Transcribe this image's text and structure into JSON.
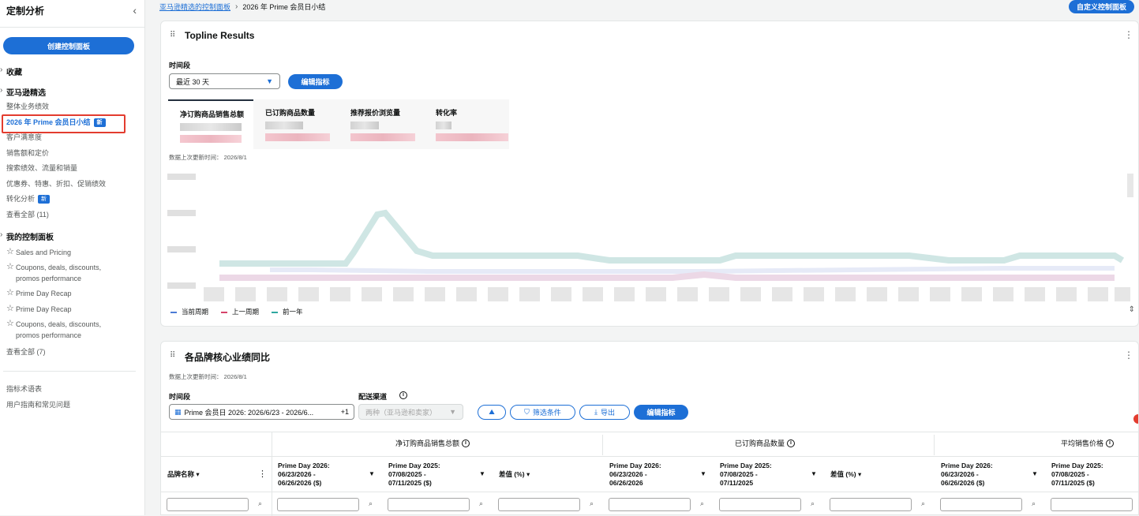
{
  "sidebar": {
    "title": "定制分析",
    "create_button": "创建控制面板",
    "favorites": "收藏",
    "amazon_section": "亚马逊精选",
    "amazon_items": [
      "整体业务绩效",
      "2026 年 Prime 会员日小结",
      "客户满意度",
      "销售额和定价",
      "搜索绩效、流量和销量",
      "优惠券、特惠、折扣、促销绩效",
      "转化分析",
      "查看全部 (11)"
    ],
    "new_badge": "新",
    "my_section": "我的控制面板",
    "my_items": [
      "Sales and Pricing",
      "Coupons, deals, discounts,\npromos performance",
      "Prime Day Recap",
      "Prime Day Recap",
      "Coupons, deals, discounts,\npromos performance"
    ],
    "my_view_all": "查看全部 (7)",
    "footer_links": [
      "指标术语表",
      "用户指南和常见问题"
    ]
  },
  "breadcrumb": {
    "parent": "亚马逊精选的控制面板",
    "current": "2026 年 Prime 会员日小结"
  },
  "customize_button": "自定义控制面板",
  "topline": {
    "title": "Topline Results",
    "period_label": "时间段",
    "period_value": "最近 30 天",
    "edit_metrics": "编辑指标",
    "metrics": [
      "净订购商品销售总额",
      "已订购商品数量",
      "推荐报价浏览量",
      "转化率"
    ],
    "last_updated": "数据上次更新时间： 2026/8/1",
    "legend": [
      {
        "label": "当前周期",
        "color": "#4b7bd6"
      },
      {
        "label": "上一周期",
        "color": "#d6436a"
      },
      {
        "label": "前一年",
        "color": "#2fa7a0"
      }
    ]
  },
  "brand": {
    "title": "各品牌核心业绩同比",
    "last_updated": "数据上次更新时间： 2026/8/1",
    "period_label": "时间段",
    "period_value": "Prime 会员日 2026: 2026/6/23 - 2026/6...",
    "period_extra": "+1",
    "channel_label": "配送渠道",
    "channel_value": "两种（亚马逊和卖家）",
    "filter_button": "筛选条件",
    "export_button": "导出",
    "edit_metrics": "编辑指标",
    "groups": [
      "净订购商品销售总额",
      "已订购商品数量",
      "平均销售价格"
    ],
    "brand_col": "品牌名称",
    "columns": [
      "Prime Day 2026:\n06/23/2026 -\n06/26/2026 ($)",
      "Prime Day 2025:\n07/08/2025 -\n07/11/2025 ($)",
      "差值 (%)",
      "Prime Day 2026:\n06/23/2026 -\n06/26/2026",
      "Prime Day 2025:\n07/08/2025 -\n07/11/2025",
      "差值 (%)",
      "Prime Day 2026:\n06/23/2026 -\n06/26/2026 ($)",
      "Prime Day 2025:\n07/08/2025 -\n07/11/2025 ($)"
    ]
  }
}
